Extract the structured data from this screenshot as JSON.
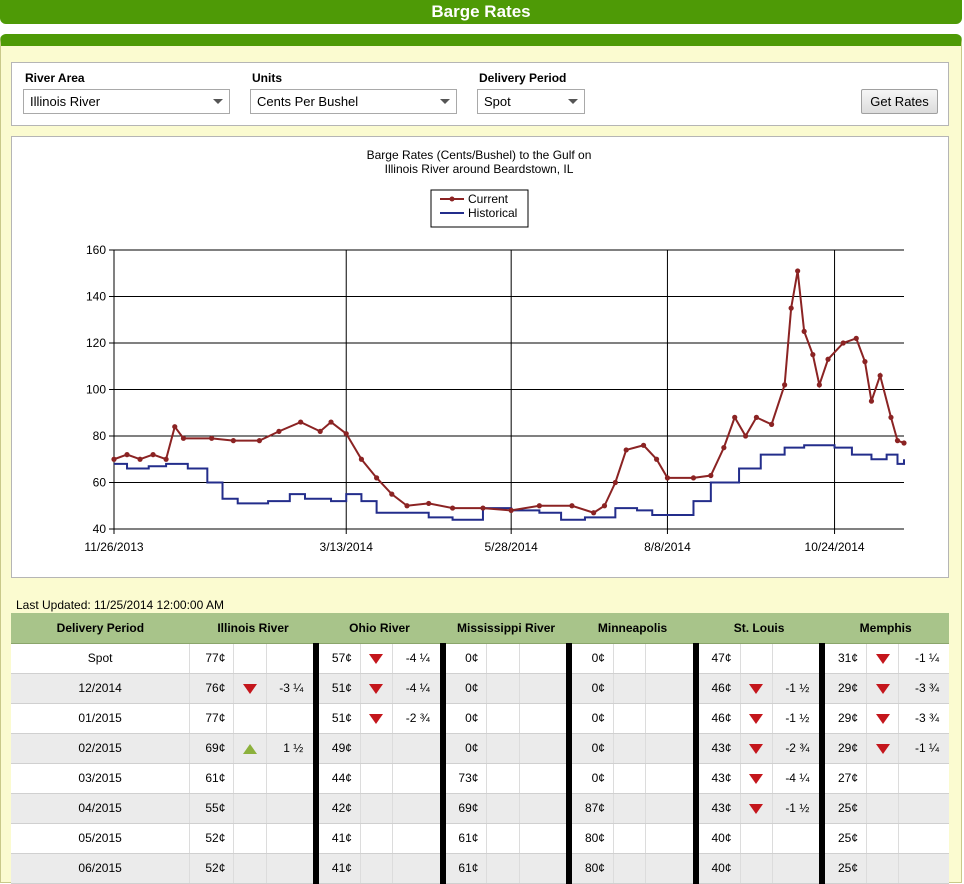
{
  "page": {
    "title": "Barge Rates"
  },
  "controls": {
    "river_area": {
      "label": "River Area",
      "value": "Illinois River"
    },
    "units": {
      "label": "Units",
      "value": "Cents Per Bushel"
    },
    "delivery_period": {
      "label": "Delivery Period",
      "value": "Spot"
    },
    "get_rates_label": "Get Rates"
  },
  "colors": {
    "current": "#8b2323",
    "historical": "#232d8b",
    "header_green": "#4e9a06",
    "table_header": "#a8c48a",
    "down": "#c4161c",
    "up": "#8cb13c"
  },
  "chart_data": {
    "type": "line",
    "title": "Barge Rates (Cents/Bushel) to the Gulf on",
    "subtitle": "Illinois River around Beardstown, IL",
    "x_ticks": [
      "11/26/2013",
      "3/13/2014",
      "5/28/2014",
      "8/8/2014",
      "10/24/2014"
    ],
    "x_range": [
      "11/26/2013",
      "11/25/2014"
    ],
    "ylim": [
      40,
      160
    ],
    "y_ticks": [
      40,
      60,
      80,
      100,
      120,
      140,
      160
    ],
    "grid": true,
    "legend_position": "top-center",
    "series": [
      {
        "name": "Current",
        "marker": "circle",
        "points": [
          [
            "11/26/2013",
            70
          ],
          [
            "12/2/2013",
            72
          ],
          [
            "12/8/2013",
            70
          ],
          [
            "12/14/2013",
            72
          ],
          [
            "12/20/2013",
            70
          ],
          [
            "12/24/2013",
            84
          ],
          [
            "12/28/2013",
            79
          ],
          [
            "1/10/2014",
            79
          ],
          [
            "1/20/2014",
            78
          ],
          [
            "2/1/2014",
            78
          ],
          [
            "2/10/2014",
            82
          ],
          [
            "2/20/2014",
            86
          ],
          [
            "3/1/2014",
            82
          ],
          [
            "3/6/2014",
            86
          ],
          [
            "3/13/2014",
            81
          ],
          [
            "3/20/2014",
            70
          ],
          [
            "3/27/2014",
            62
          ],
          [
            "4/3/2014",
            55
          ],
          [
            "4/10/2014",
            50
          ],
          [
            "4/20/2014",
            51
          ],
          [
            "5/1/2014",
            49
          ],
          [
            "5/15/2014",
            49
          ],
          [
            "5/28/2014",
            48
          ],
          [
            "6/10/2014",
            50
          ],
          [
            "6/25/2014",
            50
          ],
          [
            "7/5/2014",
            47
          ],
          [
            "7/10/2014",
            50
          ],
          [
            "7/15/2014",
            60
          ],
          [
            "7/20/2014",
            74
          ],
          [
            "7/28/2014",
            76
          ],
          [
            "8/3/2014",
            70
          ],
          [
            "8/8/2014",
            62
          ],
          [
            "8/20/2014",
            62
          ],
          [
            "8/28/2014",
            63
          ],
          [
            "9/3/2014",
            75
          ],
          [
            "9/8/2014",
            88
          ],
          [
            "9/13/2014",
            80
          ],
          [
            "9/18/2014",
            88
          ],
          [
            "9/25/2014",
            85
          ],
          [
            "10/1/2014",
            102
          ],
          [
            "10/4/2014",
            135
          ],
          [
            "10/7/2014",
            151
          ],
          [
            "10/10/2014",
            125
          ],
          [
            "10/14/2014",
            115
          ],
          [
            "10/17/2014",
            102
          ],
          [
            "10/21/2014",
            113
          ],
          [
            "10/28/2014",
            120
          ],
          [
            "11/3/2014",
            122
          ],
          [
            "11/7/2014",
            112
          ],
          [
            "11/10/2014",
            95
          ],
          [
            "11/14/2014",
            106
          ],
          [
            "11/19/2014",
            88
          ],
          [
            "11/22/2014",
            78
          ],
          [
            "11/25/2014",
            77
          ]
        ]
      },
      {
        "name": "Historical",
        "points": [
          [
            "11/26/2013",
            68
          ],
          [
            "12/2/2013",
            66
          ],
          [
            "12/12/2013",
            67
          ],
          [
            "12/20/2013",
            68
          ],
          [
            "12/30/2013",
            66
          ],
          [
            "1/8/2014",
            60
          ],
          [
            "1/15/2014",
            53
          ],
          [
            "1/22/2014",
            51
          ],
          [
            "2/5/2014",
            52
          ],
          [
            "2/15/2014",
            55
          ],
          [
            "2/22/2014",
            53
          ],
          [
            "3/6/2014",
            52
          ],
          [
            "3/13/2014",
            55
          ],
          [
            "3/20/2014",
            52
          ],
          [
            "3/27/2014",
            47
          ],
          [
            "4/10/2014",
            47
          ],
          [
            "4/20/2014",
            45
          ],
          [
            "5/1/2014",
            44
          ],
          [
            "5/15/2014",
            49
          ],
          [
            "5/28/2014",
            48
          ],
          [
            "6/10/2014",
            47
          ],
          [
            "6/20/2014",
            44
          ],
          [
            "7/1/2014",
            45
          ],
          [
            "7/15/2014",
            49
          ],
          [
            "7/25/2014",
            48
          ],
          [
            "8/1/2014",
            46
          ],
          [
            "8/8/2014",
            46
          ],
          [
            "8/20/2014",
            52
          ],
          [
            "8/28/2014",
            60
          ],
          [
            "9/10/2014",
            66
          ],
          [
            "9/20/2014",
            72
          ],
          [
            "10/1/2014",
            75
          ],
          [
            "10/10/2014",
            76
          ],
          [
            "10/24/2014",
            75
          ],
          [
            "11/1/2014",
            72
          ],
          [
            "11/10/2014",
            70
          ],
          [
            "11/17/2014",
            72
          ],
          [
            "11/22/2014",
            68
          ],
          [
            "11/25/2014",
            70
          ]
        ]
      }
    ]
  },
  "last_updated": "Last Updated: 11/25/2014 12:00:00 AM",
  "table": {
    "headers": [
      "Delivery Period",
      "Illinois River",
      "Ohio River",
      "Mississippi River",
      "Minneapolis",
      "St. Louis",
      "Memphis"
    ],
    "rows": [
      {
        "period": "Spot",
        "cells": [
          {
            "v": "77¢",
            "d": "",
            "c": ""
          },
          {
            "v": "57¢",
            "d": "down",
            "c": "-4 ¼"
          },
          {
            "v": "0¢",
            "d": "",
            "c": ""
          },
          {
            "v": "0¢",
            "d": "",
            "c": ""
          },
          {
            "v": "47¢",
            "d": "",
            "c": ""
          },
          {
            "v": "31¢",
            "d": "down",
            "c": "-1 ¼"
          }
        ]
      },
      {
        "period": "12/2014",
        "cells": [
          {
            "v": "76¢",
            "d": "down",
            "c": "-3 ¼"
          },
          {
            "v": "51¢",
            "d": "down",
            "c": "-4 ¼"
          },
          {
            "v": "0¢",
            "d": "",
            "c": ""
          },
          {
            "v": "0¢",
            "d": "",
            "c": ""
          },
          {
            "v": "46¢",
            "d": "down",
            "c": "-1 ½"
          },
          {
            "v": "29¢",
            "d": "down",
            "c": "-3 ¾"
          }
        ]
      },
      {
        "period": "01/2015",
        "cells": [
          {
            "v": "77¢",
            "d": "",
            "c": ""
          },
          {
            "v": "51¢",
            "d": "down",
            "c": "-2 ¾"
          },
          {
            "v": "0¢",
            "d": "",
            "c": ""
          },
          {
            "v": "0¢",
            "d": "",
            "c": ""
          },
          {
            "v": "46¢",
            "d": "down",
            "c": "-1 ½"
          },
          {
            "v": "29¢",
            "d": "down",
            "c": "-3 ¾"
          }
        ]
      },
      {
        "period": "02/2015",
        "cells": [
          {
            "v": "69¢",
            "d": "up",
            "c": "1 ½"
          },
          {
            "v": "49¢",
            "d": "",
            "c": ""
          },
          {
            "v": "0¢",
            "d": "",
            "c": ""
          },
          {
            "v": "0¢",
            "d": "",
            "c": ""
          },
          {
            "v": "43¢",
            "d": "down",
            "c": "-2 ¾"
          },
          {
            "v": "29¢",
            "d": "down",
            "c": "-1 ¼"
          }
        ]
      },
      {
        "period": "03/2015",
        "cells": [
          {
            "v": "61¢",
            "d": "",
            "c": ""
          },
          {
            "v": "44¢",
            "d": "",
            "c": ""
          },
          {
            "v": "73¢",
            "d": "",
            "c": ""
          },
          {
            "v": "0¢",
            "d": "",
            "c": ""
          },
          {
            "v": "43¢",
            "d": "down",
            "c": "-4 ¼"
          },
          {
            "v": "27¢",
            "d": "",
            "c": ""
          }
        ]
      },
      {
        "period": "04/2015",
        "cells": [
          {
            "v": "55¢",
            "d": "",
            "c": ""
          },
          {
            "v": "42¢",
            "d": "",
            "c": ""
          },
          {
            "v": "69¢",
            "d": "",
            "c": ""
          },
          {
            "v": "87¢",
            "d": "",
            "c": ""
          },
          {
            "v": "43¢",
            "d": "down",
            "c": "-1 ½"
          },
          {
            "v": "25¢",
            "d": "",
            "c": ""
          }
        ]
      },
      {
        "period": "05/2015",
        "cells": [
          {
            "v": "52¢",
            "d": "",
            "c": ""
          },
          {
            "v": "41¢",
            "d": "",
            "c": ""
          },
          {
            "v": "61¢",
            "d": "",
            "c": ""
          },
          {
            "v": "80¢",
            "d": "",
            "c": ""
          },
          {
            "v": "40¢",
            "d": "",
            "c": ""
          },
          {
            "v": "25¢",
            "d": "",
            "c": ""
          }
        ]
      },
      {
        "period": "06/2015",
        "cells": [
          {
            "v": "52¢",
            "d": "",
            "c": ""
          },
          {
            "v": "41¢",
            "d": "",
            "c": ""
          },
          {
            "v": "61¢",
            "d": "",
            "c": ""
          },
          {
            "v": "80¢",
            "d": "",
            "c": ""
          },
          {
            "v": "40¢",
            "d": "",
            "c": ""
          },
          {
            "v": "25¢",
            "d": "",
            "c": ""
          }
        ]
      }
    ]
  }
}
